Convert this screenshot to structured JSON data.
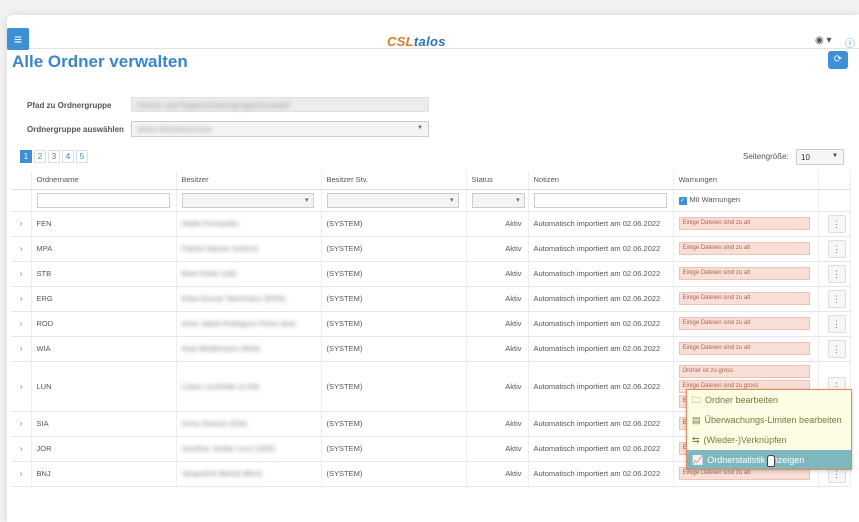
{
  "app": {
    "brand_a": "CSL",
    "brand_b": "talos",
    "user_menu": "◉ ▾",
    "info": "ⓘ"
  },
  "page": {
    "title": "Alle Ordner verwalten",
    "refresh_icon": "⟳"
  },
  "form": {
    "path_label": "Pfad zu Ordnergruppe",
    "path_value": "Ordner und Regeln/Ordnergruppe/Auswahl",
    "group_label": "Ordnergruppe auswählen",
    "group_value": "aktive Betriebsordner"
  },
  "pager": {
    "pages": [
      "1",
      "2",
      "3",
      "4",
      "5"
    ],
    "active": "1",
    "size_label": "Seitengröße:",
    "size_value": "10"
  },
  "table": {
    "columns": [
      "Ordnername",
      "Besitzer",
      "Besitzer Stv.",
      "Status",
      "Notizen",
      "Warnungen"
    ],
    "filter_checkbox": "Mit Warnungen",
    "rows": [
      {
        "name": "FEN",
        "owner": "Haide Fernandez",
        "deputy": "(SYSTEM)",
        "status": "Aktiv",
        "notes": "Automatisch importiert am 02.06.2022",
        "warnings": [
          "Einige Dateien sind zu alt"
        ]
      },
      {
        "name": "MPA",
        "owner": "Patrick Maurer (extern)",
        "deputy": "(SYSTEM)",
        "status": "Aktiv",
        "notes": "Automatisch importiert am 02.06.2022",
        "warnings": [
          "Einige Dateien sind zu alt"
        ]
      },
      {
        "name": "STB",
        "owner": "Beat Huber (stb)",
        "deputy": "(SYSTEM)",
        "status": "Aktiv",
        "notes": "Automatisch importiert am 02.06.2022",
        "warnings": [
          "Einige Dateien sind zu alt"
        ]
      },
      {
        "name": "ERG",
        "owner": "Erika Gruner Steinmann (ERG)",
        "deputy": "(SYSTEM)",
        "status": "Aktiv",
        "notes": "Automatisch importiert am 02.06.2022",
        "warnings": [
          "Einige Dateien sind zu alt"
        ]
      },
      {
        "name": "ROD",
        "owner": "Irene Jakob Rodriguez Perez (ext)",
        "deputy": "(SYSTEM)",
        "status": "Aktiv",
        "notes": "Automatisch importiert am 02.06.2022",
        "warnings": [
          "Einige Dateien sind zu alt"
        ]
      },
      {
        "name": "WIA",
        "owner": "Anja Wiedemann (WIA)",
        "deputy": "(SYSTEM)",
        "status": "Aktiv",
        "notes": "Automatisch importiert am 02.06.2022",
        "warnings": [
          "Einige Dateien sind zu alt"
        ]
      },
      {
        "name": "LUN",
        "owner": "Lukas Lunzhofer (LUN)",
        "deputy": "(SYSTEM)",
        "status": "Aktiv",
        "notes": "Automatisch importiert am 02.06.2022",
        "warnings": [
          "Ordner ist zu gross",
          "Einige Dateien sind zu gross",
          "Einige Dateien sind zu alt"
        ]
      },
      {
        "name": "SIA",
        "owner": "Anna Simonis (SIA)",
        "deputy": "(SYSTEM)",
        "status": "Aktiv",
        "notes": "Automatisch importiert am 02.06.2022",
        "warnings": [
          "Einige Dateien sind zu alt"
        ]
      },
      {
        "name": "JOR",
        "owner": "Josefine Jordan Lenz (JOR)",
        "deputy": "(SYSTEM)",
        "status": "Aktiv",
        "notes": "Automatisch importiert am 02.06.2022",
        "warnings": [
          "Einige Dateien sind zu alt"
        ]
      },
      {
        "name": "BNJ",
        "owner": "Jacqueline Benoit (BNJ)",
        "deputy": "(SYSTEM)",
        "status": "Aktiv",
        "notes": "Automatisch importiert am 02.06.2022",
        "warnings": [
          "Einige Dateien sind zu alt"
        ]
      }
    ]
  },
  "context_menu": {
    "items": [
      {
        "icon": "folder-icon",
        "glyph": "🗀",
        "label": "Ordner bearbeiten"
      },
      {
        "icon": "limits-icon",
        "glyph": "▤",
        "label": "Überwachungs-Limiten bearbeiten"
      },
      {
        "icon": "link-icon",
        "glyph": "⇆",
        "label": "(Wieder-)Verknüpfen"
      },
      {
        "icon": "chart-icon",
        "glyph": "📈",
        "label": "Ordnerstatistik anzeigen"
      }
    ],
    "highlighted": 3
  }
}
